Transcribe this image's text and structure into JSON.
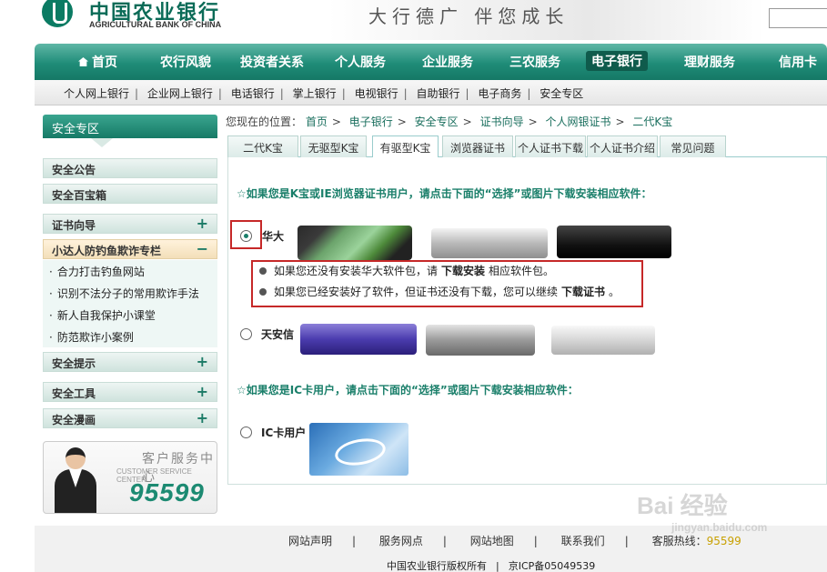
{
  "header": {
    "bank_name_cn": "中国农业银行",
    "bank_name_en": "AGRICULTURAL BANK OF CHINA",
    "slogan": "大行德广  伴您成长"
  },
  "nav": {
    "items": [
      "首页",
      "农行风貌",
      "投资者关系",
      "个人服务",
      "企业服务",
      "三农服务",
      "电子银行",
      "理财服务",
      "信用卡"
    ],
    "active": "电子银行"
  },
  "subnav": {
    "items": [
      "个人网上银行",
      "企业网上银行",
      "电话银行",
      "掌上银行",
      "电视银行",
      "自助银行",
      "电子商务",
      "安全专区"
    ]
  },
  "sidebar": {
    "title": "安全专区",
    "sections": [
      "安全公告",
      "安全百宝箱",
      "证书向导",
      "小达人防钓鱼欺诈专栏",
      "安全提示",
      "安全工具",
      "安全漫画"
    ],
    "open_section_links": [
      "合力打击钓鱼网站",
      "识别不法分子的常用欺诈手法",
      "新人自我保护小课堂",
      "防范欺诈小案例"
    ],
    "plus": "+",
    "minus": "−",
    "customer_service": {
      "title": "客户服务中心",
      "subtitle": "CUSTOMER SERVICE CENTER",
      "phone": "95599"
    }
  },
  "breadcrumb": {
    "prefix": "您现在的位置：",
    "items": [
      "首页",
      "电子银行",
      "安全专区",
      "证书向导",
      "个人网银证书",
      "二代K宝"
    ],
    "arrow": ">"
  },
  "tabs": {
    "items": [
      "二代K宝",
      "无驱型K宝",
      "有驱型K宝",
      "浏览器证书",
      "个人证书下载",
      "个人证书介绍",
      "常见问题"
    ],
    "active": "有驱型K宝"
  },
  "content": {
    "instruction_kbao": "☆如果您是K宝或IE浏览器证书用户，请点击下面的“选择”或图片下载安装相应软件：",
    "vendor_huada": "华大",
    "hint1_pre": "如果您还没有安装华大软件包，请",
    "hint1_link": "下载安装",
    "hint1_post": "相应软件包。",
    "hint2_pre": "如果您已经安装好了软件，但证书还没有下载，您可以继续",
    "hint2_link": "下载证书",
    "hint2_post": "。",
    "vendor_tianan": "天安信",
    "instruction_ic": "☆如果您是IC卡用户，请点击下面的“选择”或图片下载安装相应软件：",
    "vendor_ic": "IC卡用户"
  },
  "footer": {
    "links": [
      "网站声明",
      "服务网点",
      "网站地图",
      "联系我们"
    ],
    "hotline_label": "客服热线：",
    "hotline": "95599",
    "separator": "|",
    "copyright": "中国农业银行版权所有",
    "icp": "京ICP备05049539"
  },
  "watermark": {
    "brand": "Bai 经验",
    "url": "jingyan.baidu.com"
  },
  "colors": {
    "brand_green": "#1a7f6a",
    "nav_active": "#0f5b4c",
    "highlight_red": "#c62828"
  }
}
